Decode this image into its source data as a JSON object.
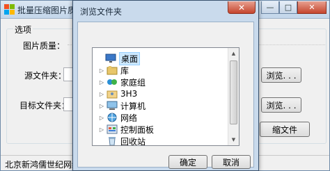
{
  "main": {
    "title": "批量压缩图片质量(大",
    "group_label": "选项",
    "quality_label": "图片质量：",
    "source_label": "源文件夹：",
    "target_label": "目标文件夹：",
    "browse_label": "浏览. . .",
    "browse2_label": "浏览. . .",
    "compress_label": "缩文件",
    "status_text": "北京新鸿儒世纪网络技术",
    "minimize": "—",
    "maximize": "□",
    "close": "✕"
  },
  "dialog": {
    "title": "浏览文件夹",
    "close": "✕",
    "ok_label": "确定",
    "cancel_label": "取消",
    "tree": [
      {
        "label": "桌面",
        "icon": "desktop-icon",
        "expandable": false,
        "selected": true
      },
      {
        "label": "库",
        "icon": "library-icon",
        "expandable": true,
        "selected": false
      },
      {
        "label": "家庭组",
        "icon": "homegroup-icon",
        "expandable": true,
        "selected": false
      },
      {
        "label": "3H3",
        "icon": "user-folder-icon",
        "expandable": true,
        "selected": false
      },
      {
        "label": "计算机",
        "icon": "computer-icon",
        "expandable": true,
        "selected": false
      },
      {
        "label": "网络",
        "icon": "network-icon",
        "expandable": true,
        "selected": false
      },
      {
        "label": "控制面板",
        "icon": "control-panel-icon",
        "expandable": true,
        "selected": false
      },
      {
        "label": "回收站",
        "icon": "recycle-bin-icon",
        "expandable": false,
        "selected": false
      }
    ]
  }
}
